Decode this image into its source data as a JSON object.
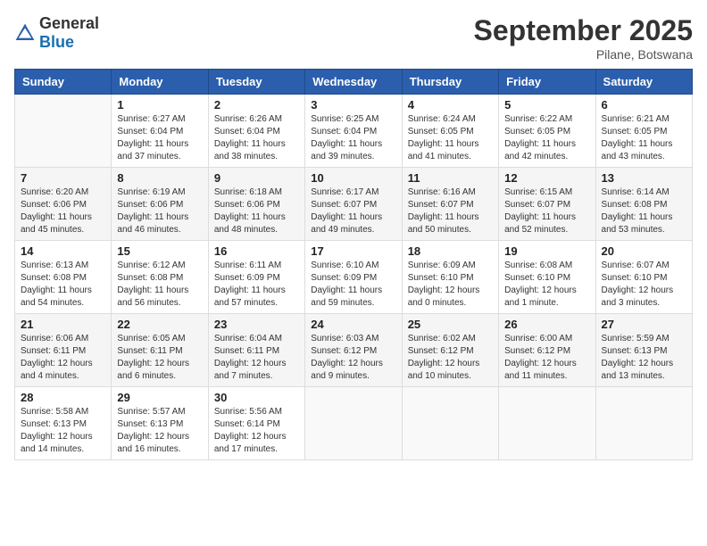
{
  "logo": {
    "general": "General",
    "blue": "Blue"
  },
  "title": "September 2025",
  "location": "Pilane, Botswana",
  "days_of_week": [
    "Sunday",
    "Monday",
    "Tuesday",
    "Wednesday",
    "Thursday",
    "Friday",
    "Saturday"
  ],
  "weeks": [
    [
      {
        "day": "",
        "info": ""
      },
      {
        "day": "1",
        "info": "Sunrise: 6:27 AM\nSunset: 6:04 PM\nDaylight: 11 hours\nand 37 minutes."
      },
      {
        "day": "2",
        "info": "Sunrise: 6:26 AM\nSunset: 6:04 PM\nDaylight: 11 hours\nand 38 minutes."
      },
      {
        "day": "3",
        "info": "Sunrise: 6:25 AM\nSunset: 6:04 PM\nDaylight: 11 hours\nand 39 minutes."
      },
      {
        "day": "4",
        "info": "Sunrise: 6:24 AM\nSunset: 6:05 PM\nDaylight: 11 hours\nand 41 minutes."
      },
      {
        "day": "5",
        "info": "Sunrise: 6:22 AM\nSunset: 6:05 PM\nDaylight: 11 hours\nand 42 minutes."
      },
      {
        "day": "6",
        "info": "Sunrise: 6:21 AM\nSunset: 6:05 PM\nDaylight: 11 hours\nand 43 minutes."
      }
    ],
    [
      {
        "day": "7",
        "info": "Sunrise: 6:20 AM\nSunset: 6:06 PM\nDaylight: 11 hours\nand 45 minutes."
      },
      {
        "day": "8",
        "info": "Sunrise: 6:19 AM\nSunset: 6:06 PM\nDaylight: 11 hours\nand 46 minutes."
      },
      {
        "day": "9",
        "info": "Sunrise: 6:18 AM\nSunset: 6:06 PM\nDaylight: 11 hours\nand 48 minutes."
      },
      {
        "day": "10",
        "info": "Sunrise: 6:17 AM\nSunset: 6:07 PM\nDaylight: 11 hours\nand 49 minutes."
      },
      {
        "day": "11",
        "info": "Sunrise: 6:16 AM\nSunset: 6:07 PM\nDaylight: 11 hours\nand 50 minutes."
      },
      {
        "day": "12",
        "info": "Sunrise: 6:15 AM\nSunset: 6:07 PM\nDaylight: 11 hours\nand 52 minutes."
      },
      {
        "day": "13",
        "info": "Sunrise: 6:14 AM\nSunset: 6:08 PM\nDaylight: 11 hours\nand 53 minutes."
      }
    ],
    [
      {
        "day": "14",
        "info": "Sunrise: 6:13 AM\nSunset: 6:08 PM\nDaylight: 11 hours\nand 54 minutes."
      },
      {
        "day": "15",
        "info": "Sunrise: 6:12 AM\nSunset: 6:08 PM\nDaylight: 11 hours\nand 56 minutes."
      },
      {
        "day": "16",
        "info": "Sunrise: 6:11 AM\nSunset: 6:09 PM\nDaylight: 11 hours\nand 57 minutes."
      },
      {
        "day": "17",
        "info": "Sunrise: 6:10 AM\nSunset: 6:09 PM\nDaylight: 11 hours\nand 59 minutes."
      },
      {
        "day": "18",
        "info": "Sunrise: 6:09 AM\nSunset: 6:10 PM\nDaylight: 12 hours\nand 0 minutes."
      },
      {
        "day": "19",
        "info": "Sunrise: 6:08 AM\nSunset: 6:10 PM\nDaylight: 12 hours\nand 1 minute."
      },
      {
        "day": "20",
        "info": "Sunrise: 6:07 AM\nSunset: 6:10 PM\nDaylight: 12 hours\nand 3 minutes."
      }
    ],
    [
      {
        "day": "21",
        "info": "Sunrise: 6:06 AM\nSunset: 6:11 PM\nDaylight: 12 hours\nand 4 minutes."
      },
      {
        "day": "22",
        "info": "Sunrise: 6:05 AM\nSunset: 6:11 PM\nDaylight: 12 hours\nand 6 minutes."
      },
      {
        "day": "23",
        "info": "Sunrise: 6:04 AM\nSunset: 6:11 PM\nDaylight: 12 hours\nand 7 minutes."
      },
      {
        "day": "24",
        "info": "Sunrise: 6:03 AM\nSunset: 6:12 PM\nDaylight: 12 hours\nand 9 minutes."
      },
      {
        "day": "25",
        "info": "Sunrise: 6:02 AM\nSunset: 6:12 PM\nDaylight: 12 hours\nand 10 minutes."
      },
      {
        "day": "26",
        "info": "Sunrise: 6:00 AM\nSunset: 6:12 PM\nDaylight: 12 hours\nand 11 minutes."
      },
      {
        "day": "27",
        "info": "Sunrise: 5:59 AM\nSunset: 6:13 PM\nDaylight: 12 hours\nand 13 minutes."
      }
    ],
    [
      {
        "day": "28",
        "info": "Sunrise: 5:58 AM\nSunset: 6:13 PM\nDaylight: 12 hours\nand 14 minutes."
      },
      {
        "day": "29",
        "info": "Sunrise: 5:57 AM\nSunset: 6:13 PM\nDaylight: 12 hours\nand 16 minutes."
      },
      {
        "day": "30",
        "info": "Sunrise: 5:56 AM\nSunset: 6:14 PM\nDaylight: 12 hours\nand 17 minutes."
      },
      {
        "day": "",
        "info": ""
      },
      {
        "day": "",
        "info": ""
      },
      {
        "day": "",
        "info": ""
      },
      {
        "day": "",
        "info": ""
      }
    ]
  ]
}
